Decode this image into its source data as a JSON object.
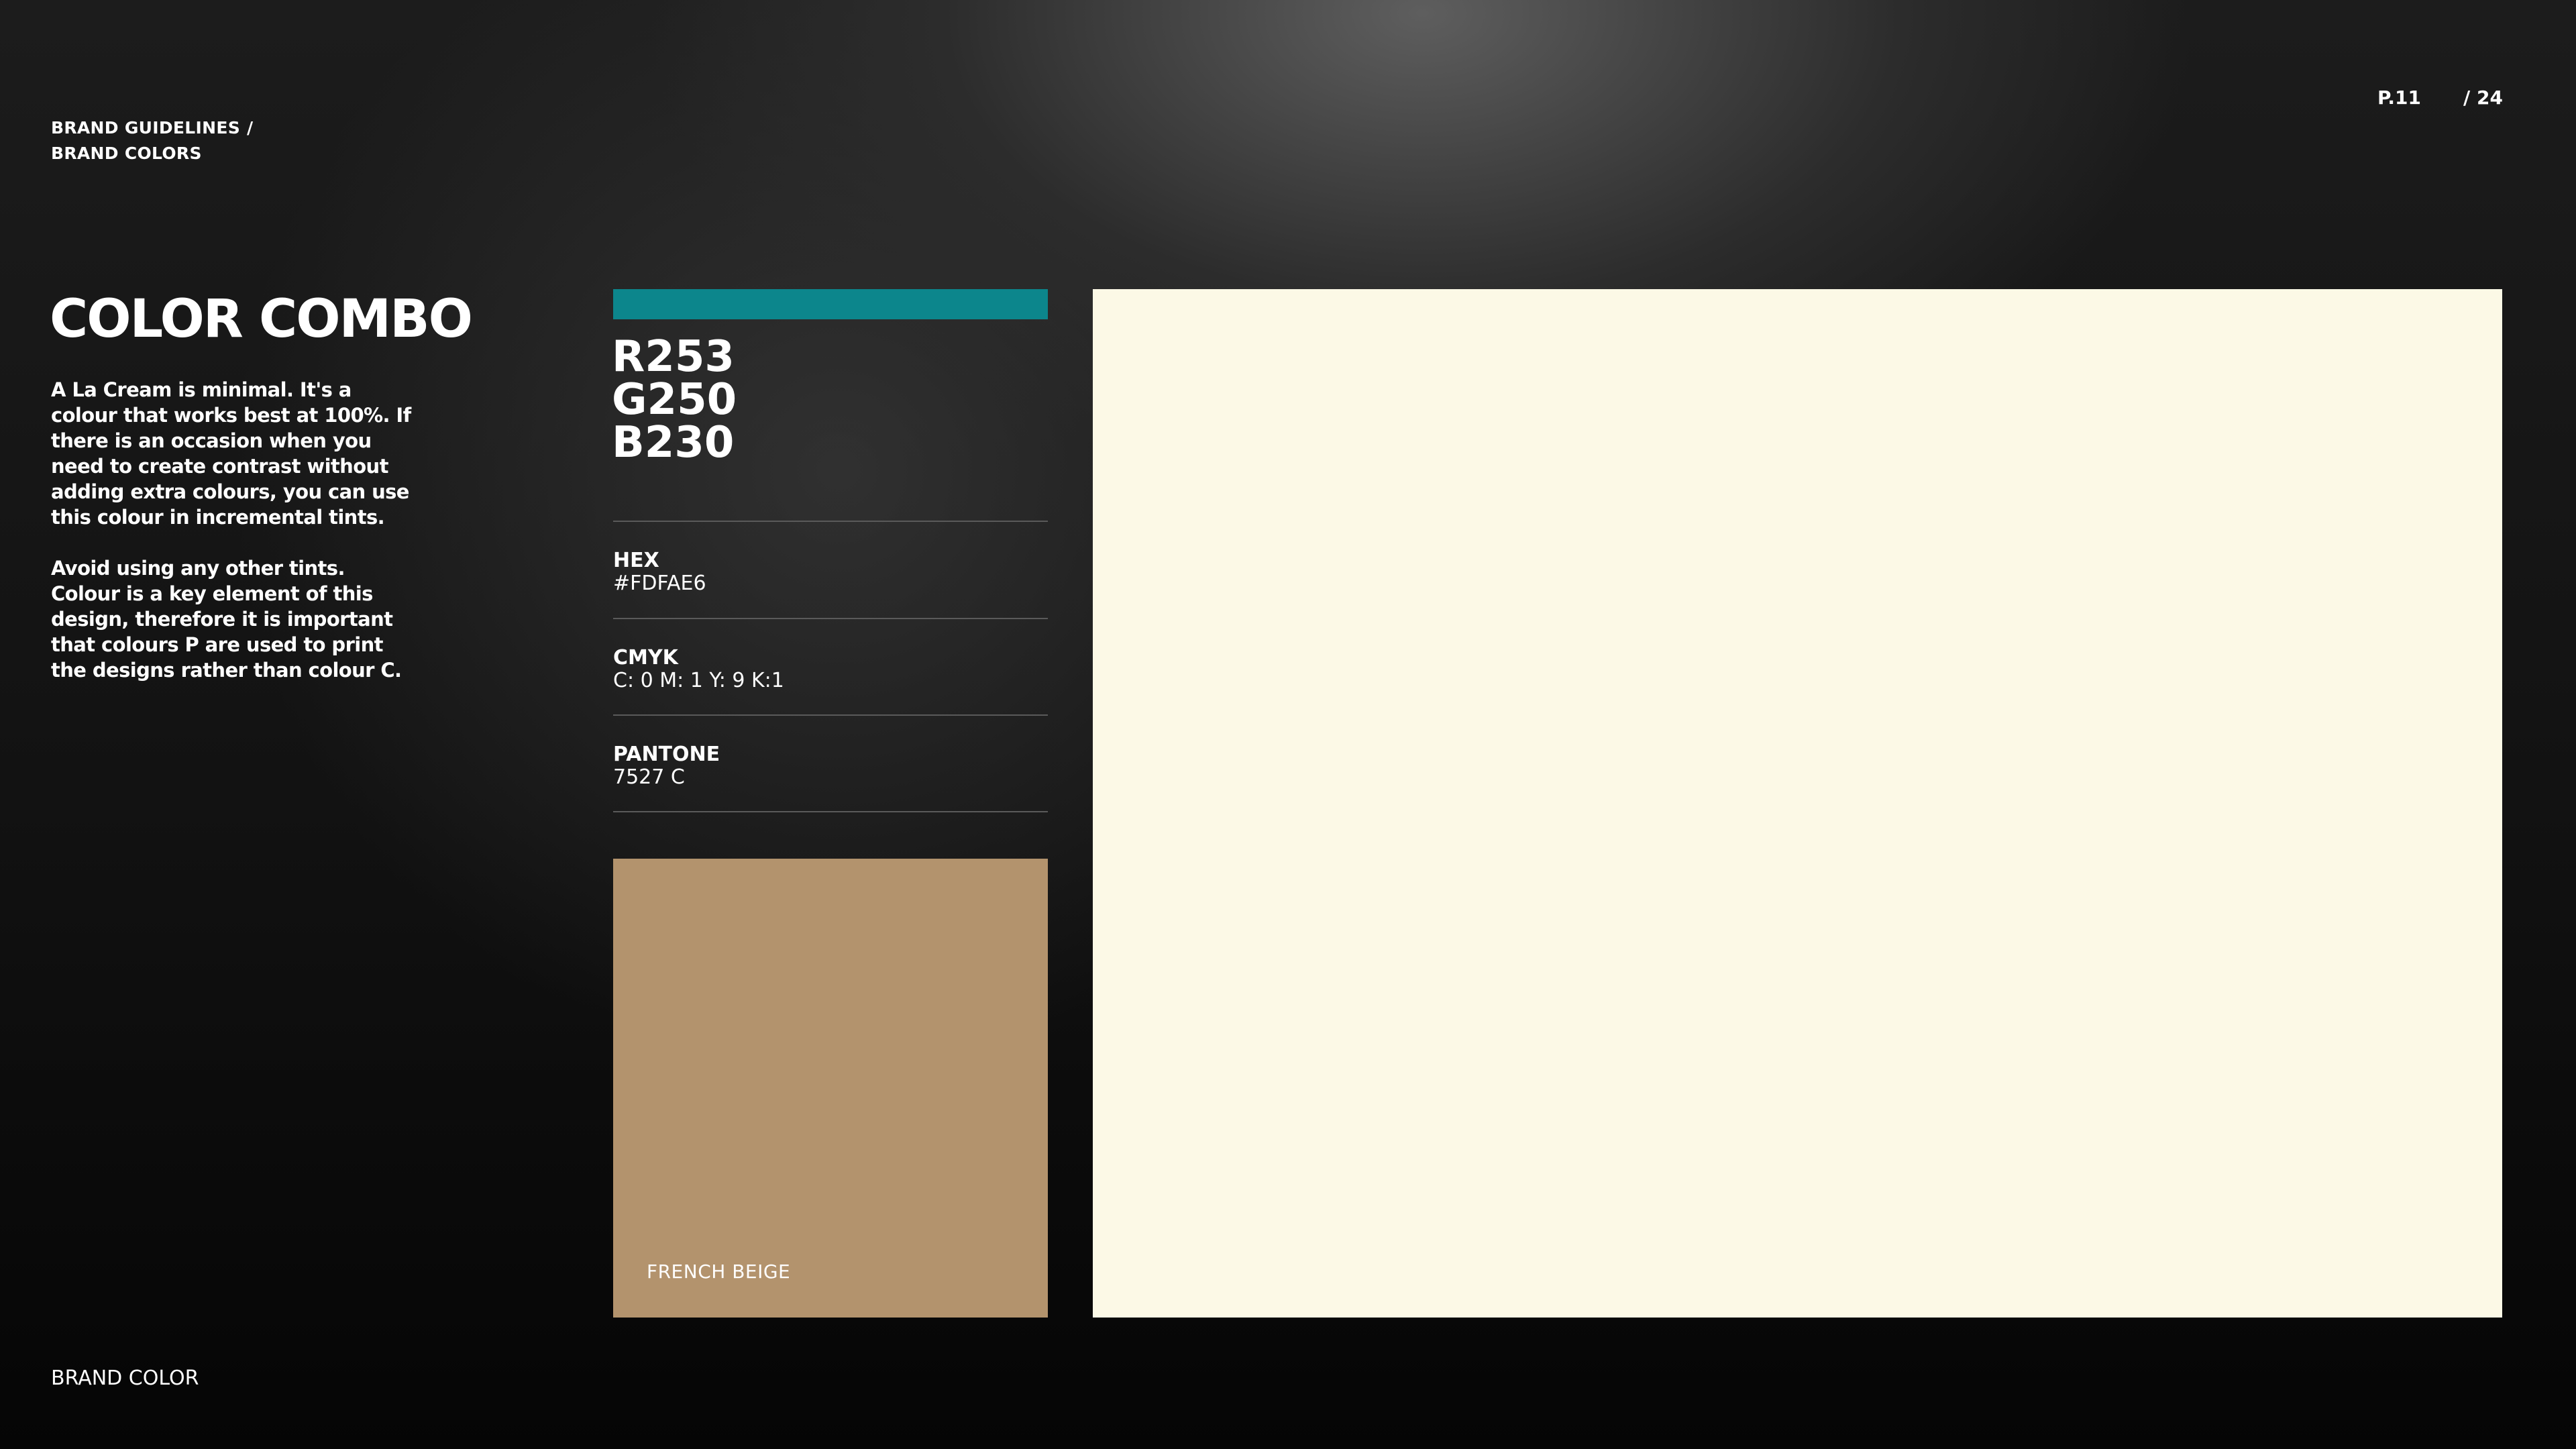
{
  "header": {
    "breadcrumb_line1": "BRAND GUIDELINES",
    "breadcrumb_sep": "/",
    "breadcrumb_line2": "BRAND COLORS",
    "page_current": "P.11",
    "page_total": "/ 24"
  },
  "main": {
    "title": "COLOR COMBO",
    "paragraph_1": "A La Cream is minimal. It's a colour that works best at 100%. If there is an occasion when you need to create contrast without adding extra colours, you can use this colour in incremental tints.",
    "paragraph_2": "Avoid using any other tints. Colour is a key element of this design, therefore it is important that colours P are used to print the designs rather than colour C."
  },
  "color_spec": {
    "accent_color": "#0C868C",
    "r": "R253",
    "g": "G250",
    "b": "B230",
    "hex_label": "HEX",
    "hex_value": "#FDFAE6",
    "cmyk_label": "CMYK",
    "cmyk_value": "C: 0 M: 1 Y: 9 K:1",
    "pantone_label": "PANTONE",
    "pantone_value": "7527 C"
  },
  "swatches": {
    "secondary_name": "FRENCH BEIGE",
    "secondary_color": "#B3936D",
    "main_color": "#FCF9E6"
  },
  "footer": {
    "label": "BRAND COLOR"
  }
}
